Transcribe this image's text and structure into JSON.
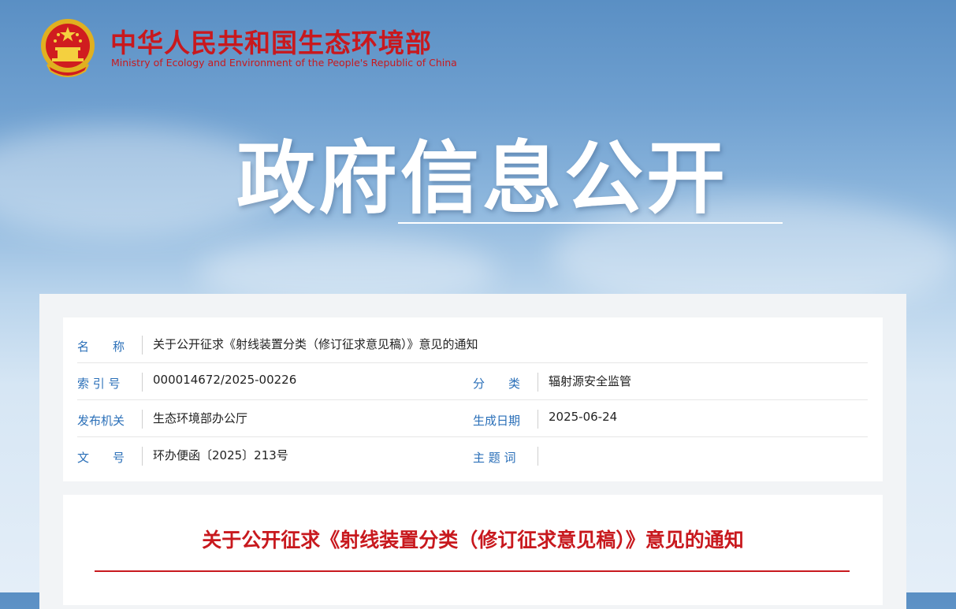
{
  "header": {
    "org_name_cn": "中华人民共和国生态环境部",
    "org_name_en": "Ministry of Ecology and Environment of the People's Republic of China",
    "hero_title": "政府信息公开"
  },
  "meta": {
    "name_label": "名　　称",
    "name_value": "关于公开征求《射线装置分类（修订征求意见稿）》意见的通知",
    "index_label": "索 引 号",
    "index_value": "000014672/2025-00226",
    "category_label": "分　　类",
    "category_value": "辐射源安全监管",
    "issuer_label": "发布机关",
    "issuer_value": "生态环境部办公厅",
    "date_label": "生成日期",
    "date_value": "2025-06-24",
    "docno_label": "文　　号",
    "docno_value": "环办便函〔2025〕213号",
    "subject_label": "主 题 词",
    "subject_value": ""
  },
  "article": {
    "title": "关于公开征求《射线装置分类（修订征求意见稿）》意见的通知"
  },
  "colors": {
    "brand_red": "#c8191e",
    "label_blue": "#2a6fb8"
  },
  "icons": {
    "emblem": "national-emblem-icon"
  }
}
